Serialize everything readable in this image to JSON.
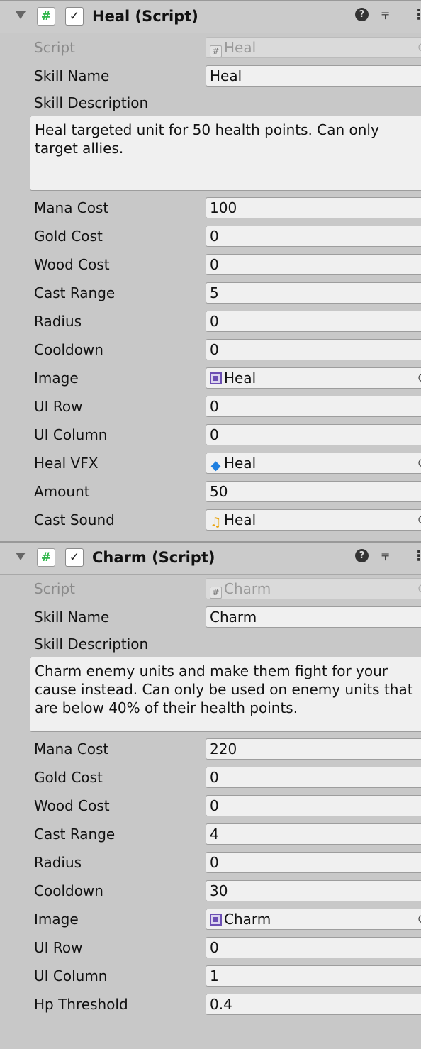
{
  "components": [
    {
      "title": "Heal (Script)",
      "script": {
        "label": "Script",
        "value": "Heal"
      },
      "skill_name": {
        "label": "Skill Name",
        "value": "Heal"
      },
      "skill_description": {
        "label": "Skill Description",
        "value": "Heal targeted unit for 50 health points. Can only target allies."
      },
      "fields": [
        {
          "label": "Mana Cost",
          "value": "100"
        },
        {
          "label": "Gold Cost",
          "value": "0"
        },
        {
          "label": "Wood Cost",
          "value": "0"
        },
        {
          "label": "Cast Range",
          "value": "5"
        },
        {
          "label": "Radius",
          "value": "0"
        },
        {
          "label": "Cooldown",
          "value": "0"
        },
        {
          "label": "Image",
          "value": "Heal",
          "icon": "sprite-icon"
        },
        {
          "label": "UI Row",
          "value": "0"
        },
        {
          "label": "UI Column",
          "value": "0"
        },
        {
          "label": "Heal VFX",
          "value": "Heal",
          "icon": "prefab-icon"
        },
        {
          "label": "Amount",
          "value": "50"
        },
        {
          "label": "Cast Sound",
          "value": "Heal",
          "icon": "audio-clip-icon"
        }
      ]
    },
    {
      "title": "Charm (Script)",
      "script": {
        "label": "Script",
        "value": "Charm"
      },
      "skill_name": {
        "label": "Skill Name",
        "value": "Charm"
      },
      "skill_description": {
        "label": "Skill Description",
        "value": "Charm enemy units and make them fight for your cause instead. Can only be used on enemy units that are below 40% of their health points."
      },
      "fields": [
        {
          "label": "Mana Cost",
          "value": "220"
        },
        {
          "label": "Gold Cost",
          "value": "0"
        },
        {
          "label": "Wood Cost",
          "value": "0"
        },
        {
          "label": "Cast Range",
          "value": "4"
        },
        {
          "label": "Radius",
          "value": "0"
        },
        {
          "label": "Cooldown",
          "value": "30"
        },
        {
          "label": "Image",
          "value": "Charm",
          "icon": "sprite-icon"
        },
        {
          "label": "UI Row",
          "value": "0"
        },
        {
          "label": "UI Column",
          "value": "1"
        },
        {
          "label": "Hp Threshold",
          "value": "0.4"
        }
      ]
    }
  ],
  "glyphs": {
    "foldout": "▼",
    "hash": "#",
    "check": "✓",
    "help": "?",
    "presets": "⫧",
    "menu": "⋮",
    "picker": "⊙",
    "prefab": "◆",
    "audio": "♫"
  }
}
